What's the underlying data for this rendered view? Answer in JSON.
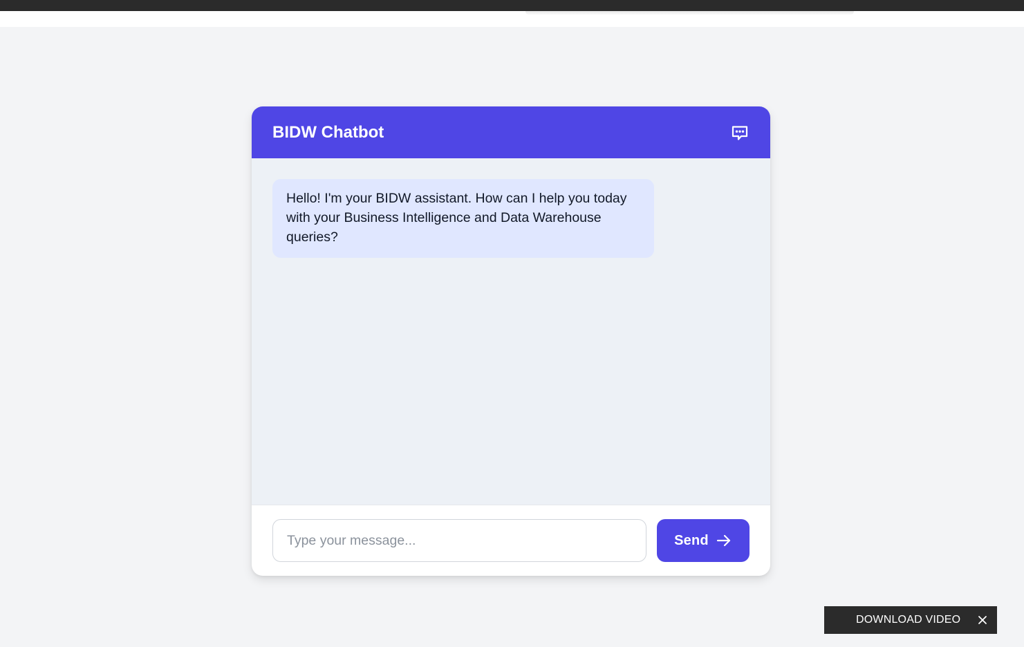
{
  "header": {
    "title": "BIDW Chatbot",
    "icon": "chat-bubble-icon"
  },
  "messages": [
    {
      "sender": "bot",
      "text": "Hello! I'm your BIDW assistant. How can I help you today with your Business Intelligence and Data Warehouse queries?"
    }
  ],
  "composer": {
    "placeholder": "Type your message...",
    "value": "",
    "send_label": "Send",
    "send_icon": "arrow-right-icon"
  },
  "download_bar": {
    "label": "DOWNLOAD VIDEO",
    "close_icon": "close-icon"
  },
  "colors": {
    "accent": "#4f46e5",
    "bot_bubble": "#e0e7ff",
    "messages_bg": "#edf1f6",
    "page_bg": "#f3f4f6"
  }
}
